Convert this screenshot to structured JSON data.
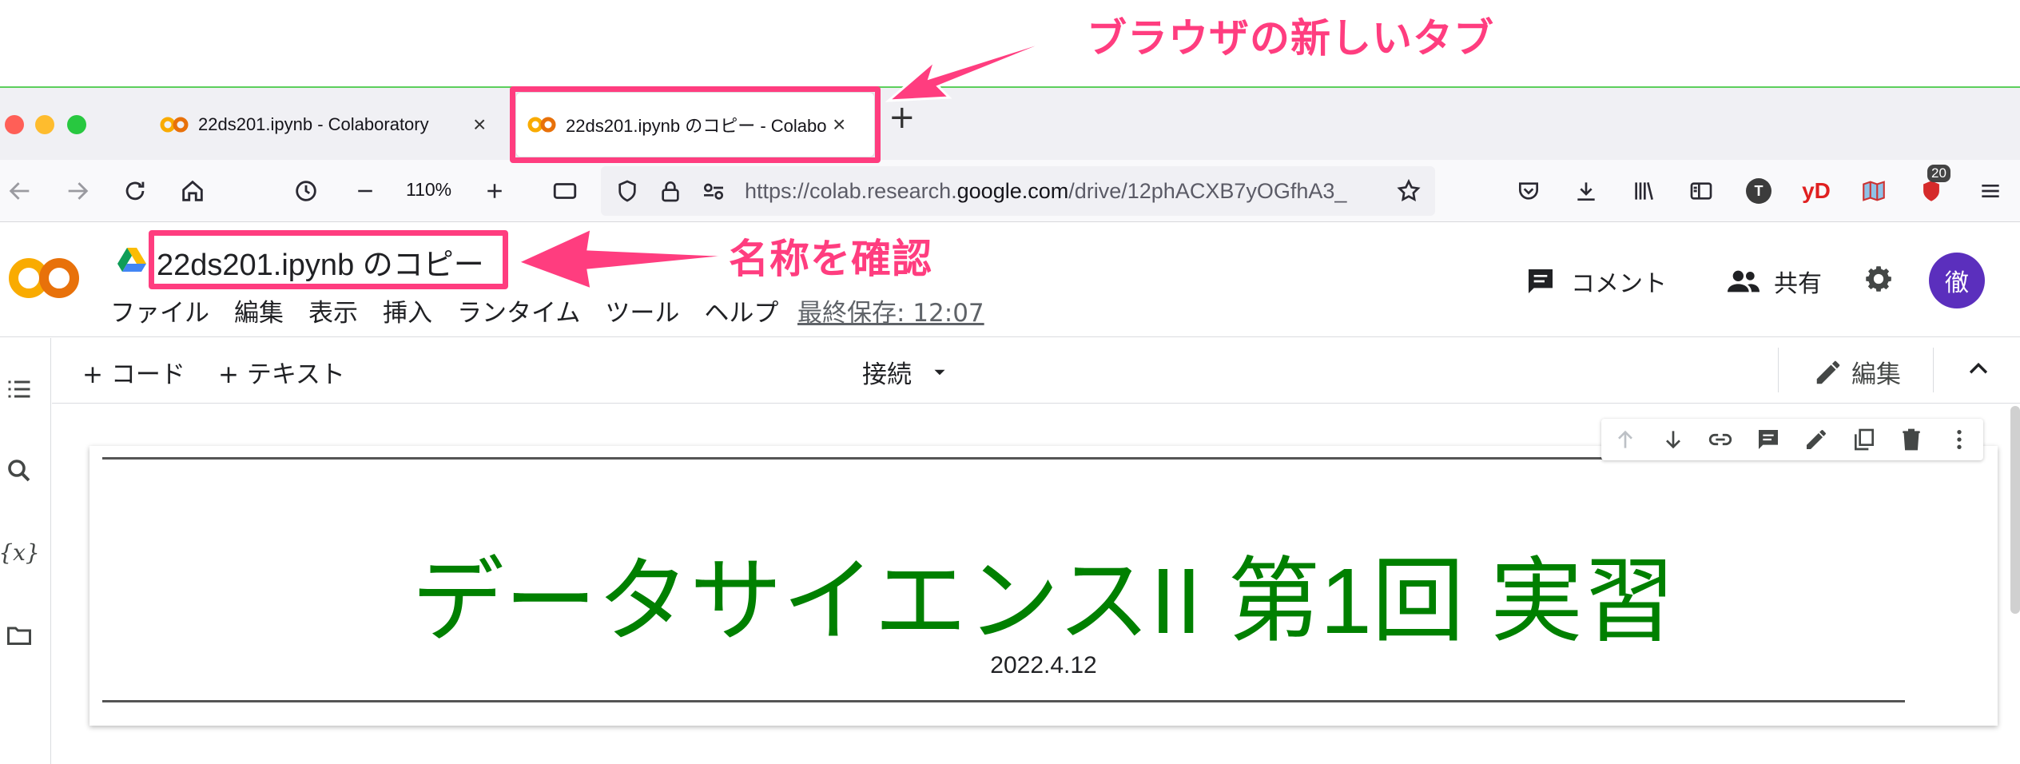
{
  "annotations": {
    "new_tab_label": "ブラウザの新しいタブ",
    "name_check_label": "名称を確認",
    "color": "#ff3d7f"
  },
  "browser": {
    "tabs": [
      {
        "title": "22ds201.ipynb - Colaboratory",
        "active": false
      },
      {
        "title": "22ds201.ipynb のコピー - Colabo",
        "active": true
      }
    ],
    "new_tab_symbol": "+",
    "zoom": "110%",
    "url_prefix": "https://colab.research.",
    "url_domain": "google.com",
    "url_path": "/drive/12phACXB7yOGfhA3_",
    "extension_badge": "20",
    "ext_t_label": "T",
    "ext_yd_label": "yD"
  },
  "colab": {
    "title": "22ds201.ipynb のコピー",
    "menu": [
      "ファイル",
      "編集",
      "表示",
      "挿入",
      "ランタイム",
      "ツール",
      "ヘルプ"
    ],
    "last_saved": "最終保存: 12:07",
    "comment_label": "コメント",
    "share_label": "共有",
    "avatar_initial": "徹",
    "toolbar": {
      "add_code": "+ コード",
      "add_text": "+ テキスト",
      "connect": "接続",
      "edit": "編集"
    },
    "cell": {
      "title": "データサイエンスII 第1回 実習",
      "date": "2022.4.12",
      "title_color": "#008000"
    },
    "rail_variable_label": "{x}"
  }
}
